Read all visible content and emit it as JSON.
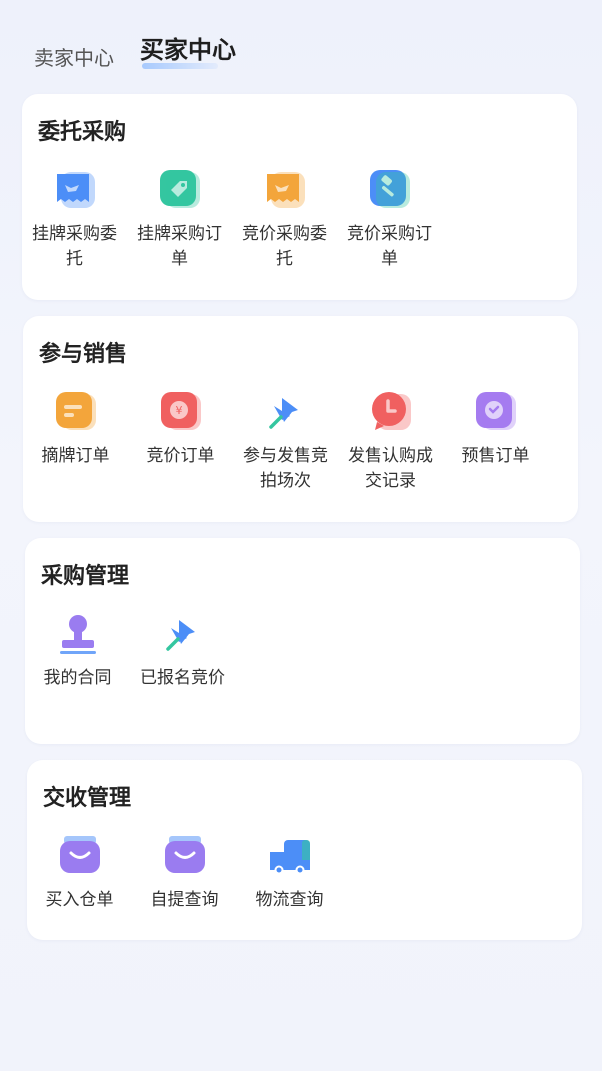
{
  "tabs": {
    "seller": "卖家中心",
    "buyer": "买家中心"
  },
  "sections": [
    {
      "title": "委托采购",
      "items": [
        {
          "label": "挂牌采购委托",
          "icon": "shopping-bag-handshake-icon",
          "color": "#4c8ef7"
        },
        {
          "label": "挂牌采购订单",
          "icon": "tag-icon",
          "color": "#34c6a0"
        },
        {
          "label": "竞价采购委托",
          "icon": "shopping-bag-handshake-icon",
          "color": "#f3a53b"
        },
        {
          "label": "竞价采购订单",
          "icon": "gavel-icon",
          "color": "#4c8ef7"
        }
      ]
    },
    {
      "title": "参与销售",
      "items": [
        {
          "label": "摘牌订单",
          "icon": "list-doc-icon",
          "color": "#f3a53b"
        },
        {
          "label": "竞价订单",
          "icon": "yuan-coin-icon",
          "color": "#f06060"
        },
        {
          "label": "参与发售竞拍场次",
          "icon": "pushpin-icon",
          "color": "#4c8ef7"
        },
        {
          "label": "发售认购成交记录",
          "icon": "clock-bubble-icon",
          "color": "#f06060"
        },
        {
          "label": "预售订单",
          "icon": "clock-check-icon",
          "color": "#a57cf0"
        }
      ]
    },
    {
      "title": "采购管理",
      "items": [
        {
          "label": "我的合同",
          "icon": "stamp-icon",
          "color": "#9a7cf0"
        },
        {
          "label": "已报名竞价",
          "icon": "pushpin-icon",
          "color": "#4c8ef7"
        }
      ]
    },
    {
      "title": "交收管理",
      "items": [
        {
          "label": "买入仓单",
          "icon": "purse-icon",
          "color": "#9a7cf0"
        },
        {
          "label": "自提查询",
          "icon": "purse-icon",
          "color": "#9a7cf0"
        },
        {
          "label": "物流查询",
          "icon": "truck-icon",
          "color": "#4c8ef7"
        }
      ]
    }
  ]
}
